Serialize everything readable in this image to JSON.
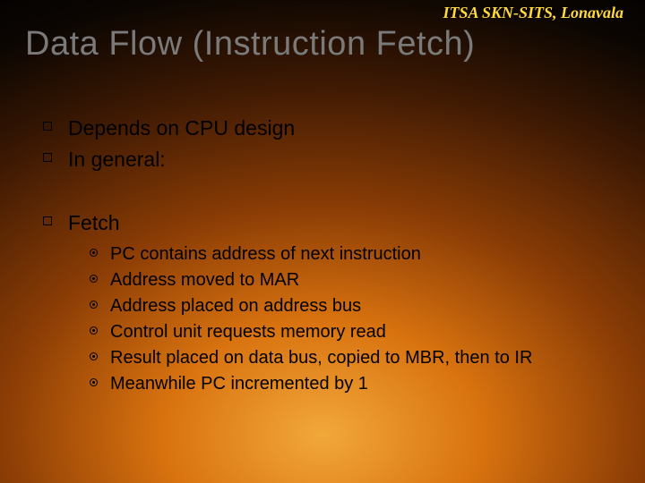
{
  "header": {
    "org": "ITSA SKN-SITS, Lonavala"
  },
  "title": "Data Flow (Instruction Fetch)",
  "bullets": [
    {
      "text": "Depends on CPU design"
    },
    {
      "text": "In general:"
    }
  ],
  "section": {
    "heading": "Fetch",
    "items": [
      "PC contains address of next instruction",
      "Address moved to MAR",
      "Address placed on address bus",
      "Control unit requests memory read",
      "Result placed on data bus, copied to MBR, then to IR",
      "Meanwhile PC incremented by 1"
    ]
  }
}
